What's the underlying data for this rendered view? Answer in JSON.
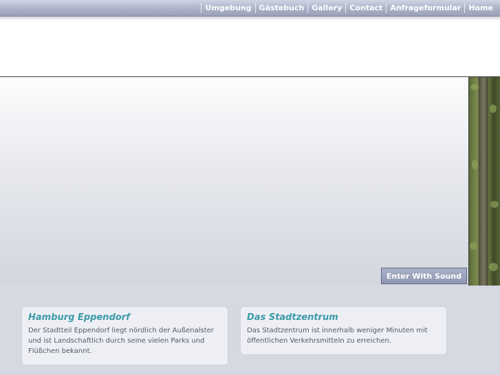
{
  "nav": {
    "items": [
      "Umgebung",
      "Gästebuch",
      "Gallery",
      "Contact",
      "Anfrageformular",
      "Home"
    ]
  },
  "hero": {
    "enter_button": "Enter With Sound"
  },
  "cards": [
    {
      "title": "Hamburg Eppendorf",
      "text": "Der Stadtteil Eppendorf liegt nördlich der Außenalster und ist Landschaftlich durch seine vielen Parks und Flüßchen bekannt."
    },
    {
      "title": "Das Stadtzentrum",
      "text": "Das Stadtzentrum ist innerhalb weniger Minuten mit öffentlichen Verkehrsmitteln zu erreichen."
    }
  ],
  "colors": {
    "accent": "#3a9aa8",
    "topbar": "#a9b0c6",
    "lower_background": "#d6d8e2"
  }
}
